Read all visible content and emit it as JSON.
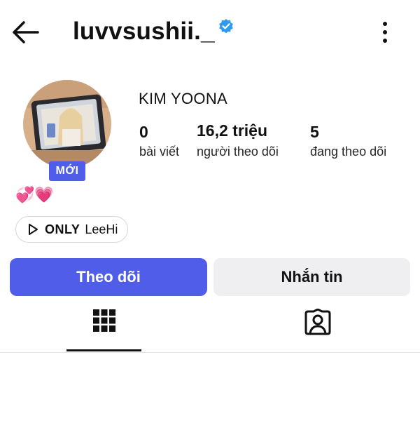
{
  "header": {
    "username": "luvvsushii._",
    "back_icon": "arrow-left-icon",
    "verified_icon": "verified-badge-icon",
    "more_icon": "more-vertical-icon",
    "verified_color": "#2e9bf0"
  },
  "profile": {
    "display_name": "KIM YOONA",
    "new_badge": "MỚI",
    "hearts": "💞💗",
    "stats": [
      {
        "value": "0",
        "label": "bài viết"
      },
      {
        "value": "16,2 triệu",
        "label": "người theo dõi"
      },
      {
        "value": "5",
        "label": "đang theo dõi"
      }
    ]
  },
  "chip": {
    "icon": "play-icon",
    "bold": "ONLY",
    "text": "LeeHi"
  },
  "actions": {
    "follow": "Theo dõi",
    "message": "Nhắn tin",
    "accent": "#4f5de8"
  },
  "tabs": {
    "grid_icon": "grid-icon",
    "tagged_icon": "tagged-person-icon",
    "active": "grid"
  }
}
